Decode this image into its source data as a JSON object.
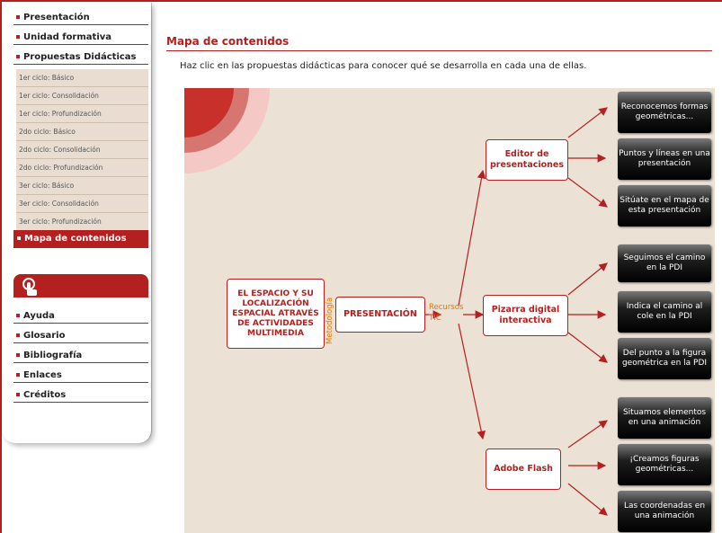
{
  "sidebar": {
    "main_items": [
      "Presentación",
      "Unidad formativa",
      "Propuestas Didácticas"
    ],
    "sub_items": [
      "1er ciclo: Básico",
      "1er ciclo: Consolidación",
      "1er ciclo: Profundización",
      "2do ciclo: Básico",
      "2do ciclo: Consolidación",
      "2do ciclo: Profundización",
      "3er ciclo: Básico",
      "3er ciclo: Consolidación",
      "3er ciclo: Profundización"
    ],
    "active_item": "Mapa de contenidos",
    "help_icon": "hand-pointer-icon",
    "bottom_items": [
      "Ayuda",
      "Glosario",
      "Bibliografía",
      "Enlaces",
      "Créditos"
    ]
  },
  "main": {
    "title": "Mapa de contenidos",
    "intro": "Haz clic en las propuestas didácticas para conocer qué se desarrolla en cada una de ellas."
  },
  "map": {
    "root": "EL ESPACIO Y SU LOCALIZACIÓN ESPACIAL ATRAVÉS DE ACTIVIDADES MULTIMEDIA",
    "label_metodologia": "Metodología",
    "presentacion": "PRESENTACIÓN",
    "label_recursos": "Recursos TIC",
    "branches": [
      {
        "name": "Editor de presentaciones",
        "items": [
          "Reconocemos formas geométricas...",
          "Puntos y líneas en una presentación",
          "Sitúate en el mapa de esta presentación"
        ]
      },
      {
        "name": "Pizarra digital interactiva",
        "items": [
          "Seguimos el camino en la PDI",
          "Indica el camino al cole en la PDI",
          "Del punto a la figura geométrica en la PDI"
        ]
      },
      {
        "name": "Adobe Flash",
        "items": [
          "Situamos elementos en una animación",
          "¡Creamos figuras geométricas...",
          "Las coordenadas en una animación"
        ]
      }
    ]
  },
  "colors": {
    "accent": "#b3201f",
    "canvas": "#ebe1d5",
    "recursos": "#e07b00"
  }
}
